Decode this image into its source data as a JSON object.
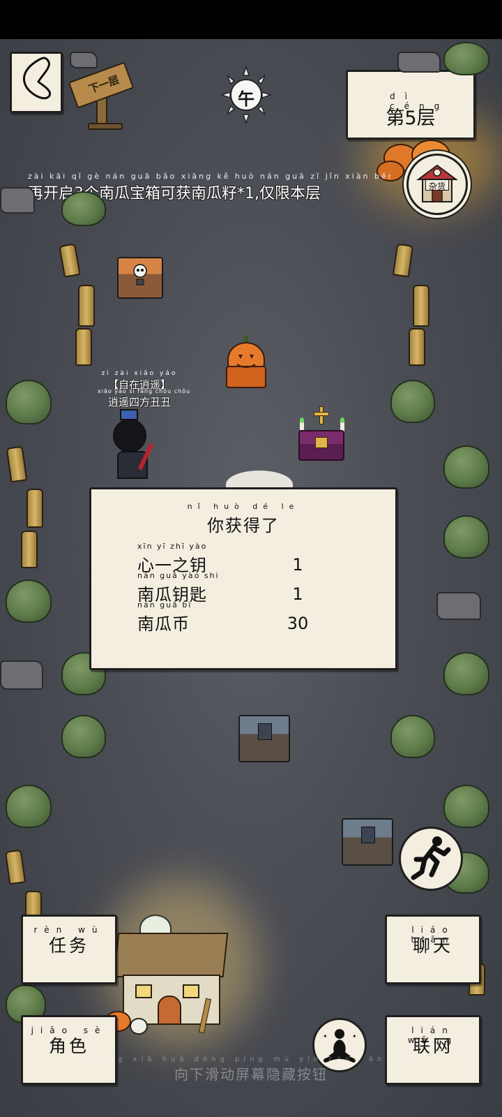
{
  "floor": {
    "label": "第5层",
    "pinyin": "dì céng"
  },
  "time_badge": {
    "label": "午"
  },
  "signpost": {
    "label": "下一层"
  },
  "shop": {
    "label": "杂货"
  },
  "banner": {
    "text": "再开启3个南瓜宝箱可获南瓜籽*1,仅限本层",
    "pinyin": "zài kāi qǐ gè nán guā bǎo xiāng kě huò nán guā zǐ jǐn xiàn běn céng"
  },
  "player": {
    "title": "【自在逍遥】",
    "title_pinyin": "zì zài xiāo yáo",
    "name": "逍遥四方丑丑",
    "name_pinyin": "xiāo yáo sì fāng chǒu chǒu"
  },
  "reward_dialog": {
    "title": "你获得了",
    "title_pinyin": "nǐ huò dé le",
    "items": [
      {
        "name": "心一之钥",
        "pinyin": "xīn yī zhī yào",
        "qty": "1"
      },
      {
        "name": "南瓜钥匙",
        "pinyin": "nán guā yào shi",
        "qty": "1"
      },
      {
        "name": "南瓜币",
        "pinyin": "nán guā bì",
        "qty": "30"
      }
    ]
  },
  "buttons": {
    "tasks": {
      "label": "任务",
      "pinyin": "rèn wù"
    },
    "role": {
      "label": "角色",
      "pinyin": "jiǎo sè"
    },
    "chat": {
      "label": "聊天",
      "pinyin": "liáo tiān"
    },
    "online": {
      "label": "联网",
      "pinyin": "lián wǎng"
    }
  },
  "hint": {
    "text": "向下滑动屏幕隐藏按钮",
    "pinyin": "xiàng xià huá dòng píng mù yǐn cáng àn niǔ"
  },
  "colors": {
    "paper": "#f4eee0",
    "ground": "#4b4d55",
    "pumpkin": "#e0782a"
  }
}
